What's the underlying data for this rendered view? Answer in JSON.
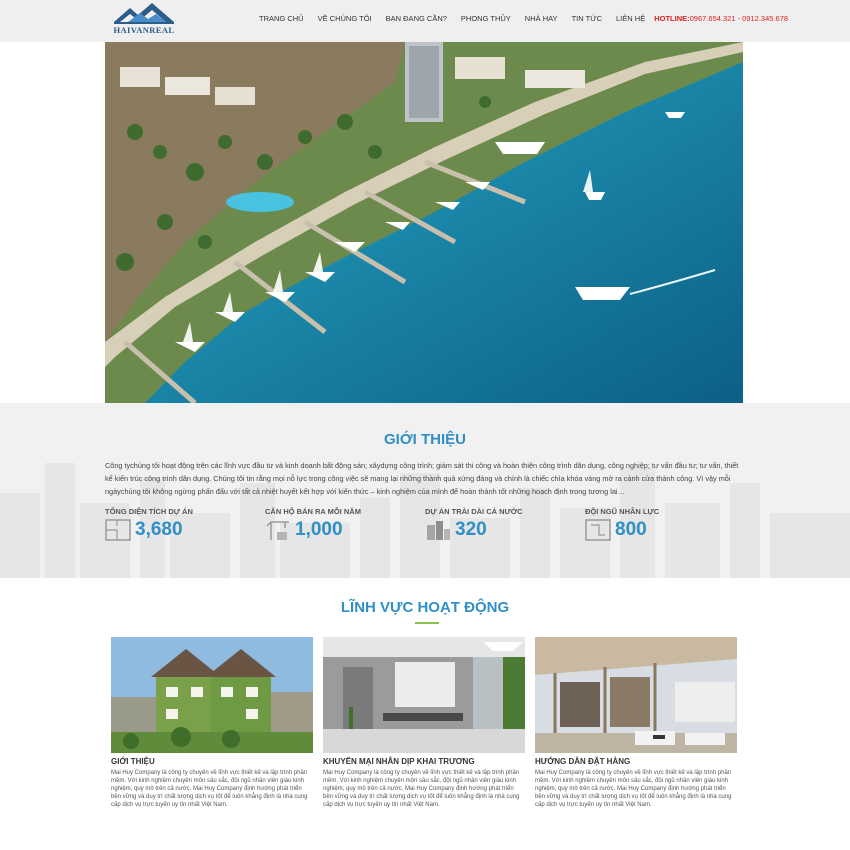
{
  "header": {
    "logo_text": "HAIVANREAL",
    "nav": [
      {
        "label": "TRANG CHỦ"
      },
      {
        "label": "VỀ CHÚNG TÔI"
      },
      {
        "label": "BẠN ĐANG CẦN?"
      },
      {
        "label": "PHONG THỦY"
      },
      {
        "label": "NHÀ HAY"
      },
      {
        "label": "TIN TỨC"
      },
      {
        "label": "LIÊN HỆ"
      }
    ],
    "hotline_label": "HOTLINE:",
    "hotline_numbers": "0967.654.321 - 0912.345.678"
  },
  "intro": {
    "title": "GIỚI THIỆU",
    "text": "Công tychúng tôi hoạt động trên các lĩnh vực đầu tư và kinh doanh bất động sản; xâydựng công trình; giám sát thi công và hoàn thiện công trình dân dụng, công nghiệp; tư vấn đầu tư; tư vấn, thiết kế kiến trúc công trình dân dụng. Chúng tôi tin rằng mọi nỗ lực trong công việc sẽ mang lại những thành quả xứng đáng và chính là chiếc chìa khóa vàng mở ra cánh cửa thành công. Vì vậy mỗi ngàychúng tôi không ngừng phấn đấu với tất cả nhiệt huyết kết hợp với kiến thức – kinh nghiệm của mình để hoàn thành tốt những hoạch định trong tương lai…",
    "stats": [
      {
        "label": "TỔNG DIỆN TÍCH DỰ ÁN",
        "value": "3,680",
        "icon": "floor-plan-icon"
      },
      {
        "label": "CĂN HỘ BÁN RA MỖI NĂM",
        "value": "1,000",
        "icon": "crane-icon"
      },
      {
        "label": "DỰ ÁN TRẢI DÀI CẢ NƯỚC",
        "value": "320",
        "icon": "buildings-icon"
      },
      {
        "label": "ĐỘI NGŨ NHÂN LỰC",
        "value": "800",
        "icon": "blueprint-icon"
      }
    ]
  },
  "fields": {
    "title": "LĨNH VỰC HOẠT ĐỘNG",
    "cards": [
      {
        "title": "GIỚI THIỆU",
        "desc": "Mai Huy Company là công ty chuyên về lĩnh vực thiết kế và lập trình phần mềm. Với kinh nghiệm chuyên môn sâu sắc, đội ngũ nhân viên giàu kinh nghiệm, quy mô trên cả nước. Mai Huy Company định hướng phát triển bền vững và duy trì chất lượng dịch vụ tốt để luôn khẳng định là nhà cung cấp dịch vụ trực tuyến uy tín nhất Việt Nam."
      },
      {
        "title": "KHUYẾN MẠI NHÂN DỊP KHAI TRƯƠNG",
        "desc": "Mai Huy Company là công ty chuyên về lĩnh vực thiết kế và lập trình phần mềm. Với kinh nghiệm chuyên môn sâu sắc, đội ngũ nhân viên giàu kinh nghiệm, quy mô trên cả nước. Mai Huy Company định hướng phát triển bền vững và duy trì chất lượng dịch vụ tốt để luôn khẳng định là nhà cung cấp dịch vụ trực tuyến uy tín nhất Việt Nam."
      },
      {
        "title": "HƯỚNG DẪN ĐẶT HÀNG",
        "desc": "Mai Huy Company là công ty chuyên về lĩnh vực thiết kế và lập trình phần mềm. Với kinh nghiệm chuyên môn sâu sắc, đội ngũ nhân viên giàu kinh nghiệm, quy mô trên cả nước. Mai Huy Company định hướng phát triển bền vững và duy trì chất lượng dịch vụ tốt để luôn khẳng định là nhà cung cấp dịch vụ trực tuyến uy tín nhất Việt Nam."
      }
    ]
  },
  "colors": {
    "accent_blue": "#2f8fc6",
    "hotline_red": "#dd2222",
    "underline_green": "#8bc34a",
    "header_bg": "#efefef"
  }
}
